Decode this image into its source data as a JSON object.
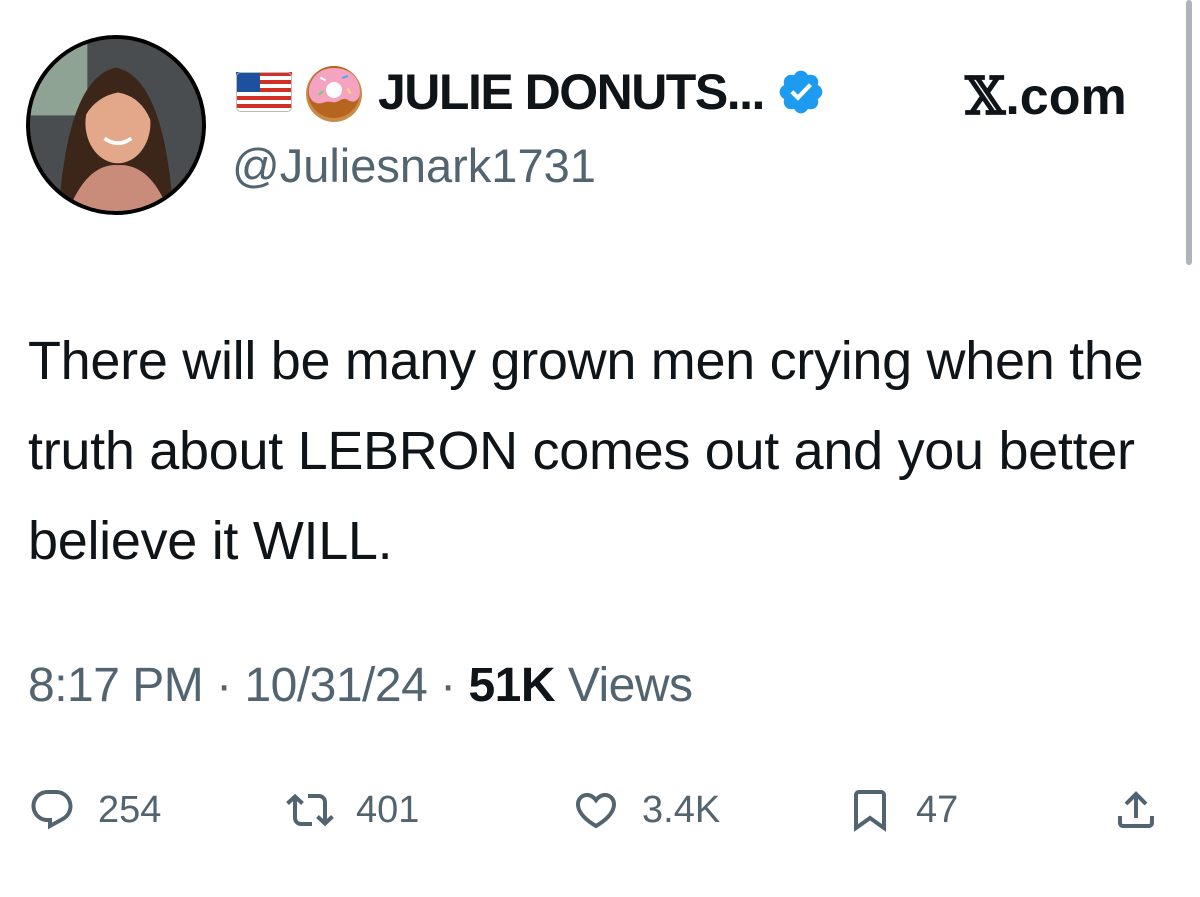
{
  "author": {
    "display_name": "JULIE DONUTS...",
    "handle": "@Juliesnark1731",
    "name_emojis": [
      "us-flag-emoji",
      "donut-emoji"
    ],
    "verified": true
  },
  "site_label": {
    "x_glyph": "𝕏",
    "suffix": ".com"
  },
  "tweet": {
    "text": "There will be many grown men crying when the truth about LEBRON comes out and you better believe it WILL.",
    "time": "8:17 PM",
    "date": "10/31/24",
    "views_count": "51K",
    "views_label": "Views",
    "separator": "·"
  },
  "actions": {
    "replies": "254",
    "reposts": "401",
    "likes": "3.4K",
    "bookmarks": "47"
  },
  "colors": {
    "text": "#0f1419",
    "secondary": "#536471",
    "verified_blue": "#1d9bf0"
  }
}
